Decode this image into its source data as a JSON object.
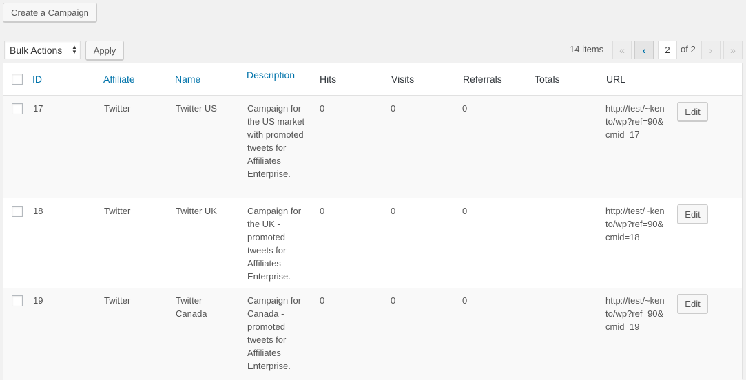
{
  "toolbar": {
    "create_label": "Create a Campaign",
    "bulk_actions_label": "Bulk Actions",
    "apply_label": "Apply"
  },
  "pagination": {
    "items_count": "14 items",
    "first": "«",
    "prev": "‹",
    "current_page": "2",
    "of_total": "of 2",
    "next": "›",
    "last": "»"
  },
  "table": {
    "headers": {
      "id": "ID",
      "affiliate": "Affiliate",
      "name": "Name",
      "description": "Description",
      "hits": "Hits",
      "visits": "Visits",
      "referrals": "Referrals",
      "totals": "Totals",
      "url": "URL"
    },
    "rows": [
      {
        "id": "17",
        "affiliate": "Twitter",
        "name": "Twitter US",
        "description": "Campaign for the US market with promoted tweets for Affiliates Enterprise.",
        "hits": "0",
        "visits": "0",
        "referrals": "0",
        "totals": "",
        "url": "http://test/~kento/wp?ref=90&cmid=17",
        "edit_label": "Edit"
      },
      {
        "id": "18",
        "affiliate": "Twitter",
        "name": "Twitter UK",
        "description": "Campaign for the UK - promoted tweets for Affiliates Enterprise.",
        "hits": "0",
        "visits": "0",
        "referrals": "0",
        "totals": "",
        "url": "http://test/~kento/wp?ref=90&cmid=18",
        "edit_label": "Edit"
      },
      {
        "id": "19",
        "affiliate": "Twitter",
        "name": "Twitter Canada",
        "description": "Campaign for Canada - promoted tweets for Affiliates Enterprise.",
        "hits": "0",
        "visits": "0",
        "referrals": "0",
        "totals": "",
        "url": "http://test/~kento/wp?ref=90&cmid=19",
        "edit_label": "Edit"
      }
    ]
  },
  "colors": {
    "link": "#0073aa",
    "background": "#f1f1f1",
    "row_alt": "#f9f9f9"
  }
}
